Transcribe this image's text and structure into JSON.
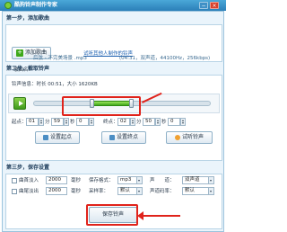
{
  "app": {
    "title": "酷狗铃声制作专家"
  },
  "window_controls": {
    "minimize": "−",
    "close": "×"
  },
  "step1": {
    "label": "第一步，添加歌曲",
    "add_button": "添加歌曲",
    "link": "试听其他人制作的铃声",
    "song_prefix": "歌曲名：",
    "song_name": "后弦 - 不完美场景 .mp3",
    "duration": "(04:31，双声道，44100Hz，256kbps)"
  },
  "step2": {
    "label": "第二步，截取铃声",
    "info": "铃声信息：时长 00:51，大小 1620KB",
    "slider": {
      "start_fraction": 0.33,
      "end_fraction": 0.55
    },
    "start_label": "起点：",
    "start_min": "01",
    "start_sec": "59",
    "start_ms": "0",
    "end_label": "终点：",
    "end_min": "02",
    "end_sec": "50",
    "end_ms": "0",
    "unit_min": "分",
    "unit_sec": "秒",
    "set_start": "设置起点",
    "set_end": "设置终点",
    "preview": "试听铃声"
  },
  "step3": {
    "label": "第三步，保存设置",
    "fade_in_label": "曲首淡入",
    "fade_in_value": "2000",
    "fade_out_label": "曲尾淡出",
    "fade_out_value": "2000",
    "ms_unit": "毫秒",
    "format_label": "保存格式：",
    "format_value": "mp3",
    "rate_label": "采样率：",
    "rate_value": "默认",
    "channel_label": "声　　道：",
    "channel_value": "双声道",
    "bitrate_label": "声道码率：",
    "bitrate_value": "默认",
    "save_button": "保存铃声"
  },
  "colors": {
    "accent_red": "#e0231b",
    "slider_green": "#3ea81a",
    "title_blue": "#2b7fb8"
  }
}
